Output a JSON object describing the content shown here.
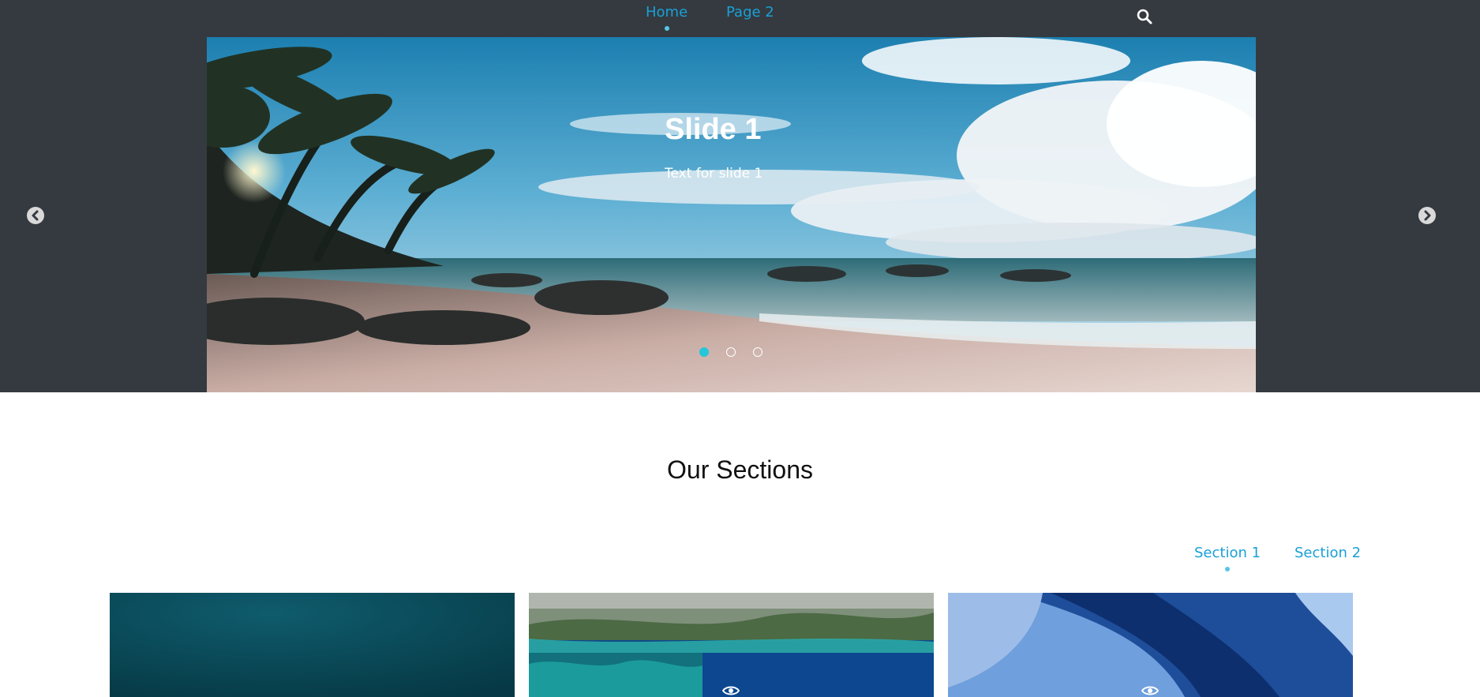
{
  "nav": {
    "items": [
      {
        "label": "Home",
        "active": true
      },
      {
        "label": "Page 2",
        "active": false
      }
    ],
    "search_icon": "search-icon"
  },
  "carousel": {
    "title": "Slide 1",
    "text": "Text for slide 1",
    "slide_count": 3,
    "active_index": 0,
    "prev_icon": "chevron-left-icon",
    "next_icon": "chevron-right-icon"
  },
  "sections": {
    "title": "Our Sections",
    "tabs": [
      {
        "label": "Section 1",
        "active": true
      },
      {
        "label": "Section 2",
        "active": false
      }
    ]
  },
  "colors": {
    "header_bg": "#343a40",
    "link": "#1aa0d6",
    "indicator_active": "#26c6da"
  }
}
